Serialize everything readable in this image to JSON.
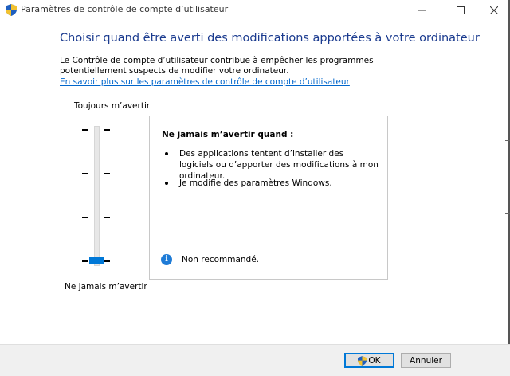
{
  "window": {
    "title": "Paramètres de contrôle de compte d’utilisateur"
  },
  "main": {
    "heading": "Choisir quand être averti des modifications apportées à votre ordinateur",
    "description": "Le Contrôle de compte d’utilisateur contribue à empêcher les programmes potentiellement suspects de modifier votre ordinateur.",
    "learn_more_link": "En savoir plus sur les paramètres de contrôle de compte d’utilisateur"
  },
  "slider": {
    "top_label": "Toujours m’avertir",
    "bottom_label": "Ne jamais m’avertir",
    "levels": 4,
    "selected_level": 1
  },
  "info": {
    "title": "Ne jamais m’avertir quand :",
    "bullets": [
      "Des applications tentent d’installer des logiciels ou d’apporter des modifications à mon ordinateur.",
      "Je modifie des paramètres Windows."
    ],
    "note": "Non recommandé."
  },
  "footer": {
    "ok_label": "OK",
    "cancel_label": "Annuler"
  },
  "colors": {
    "heading": "#1b3b8f",
    "link": "#0066cc",
    "accent": "#0078d7"
  }
}
